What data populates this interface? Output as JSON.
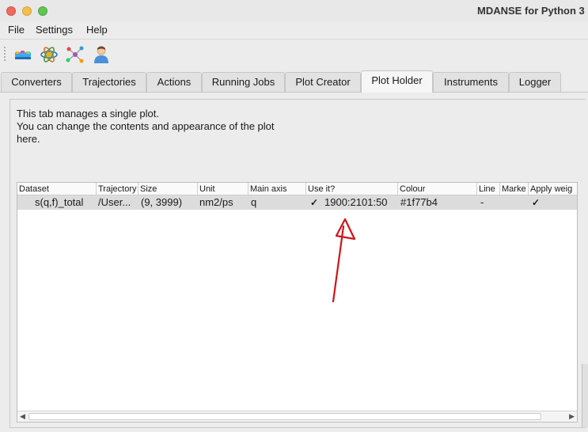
{
  "window": {
    "title": "MDANSE for Python 3"
  },
  "menu": [
    "File",
    "Settings",
    "Help"
  ],
  "toolbar": {
    "icons": [
      "loader-icon",
      "atom-icon",
      "network-icon",
      "user-icon"
    ]
  },
  "tabs": [
    "Converters",
    "Trajectories",
    "Actions",
    "Running Jobs",
    "Plot Creator",
    "Plot Holder",
    "Instruments",
    "Logger"
  ],
  "active_tab": "Plot Holder",
  "info": {
    "line1": "This tab manages a single plot.",
    "line2": "You can change the contents and appearance of the plot",
    "line3": "here."
  },
  "table": {
    "headers": [
      "Dataset",
      "Trajectory",
      "Size",
      "Unit",
      "Main axis",
      "Use it?",
      "Colour",
      "Line",
      "Marke",
      "Apply weig"
    ],
    "row": {
      "dataset": "s(q,f)_total",
      "trajectory": "/User...",
      "size": "(9, 3999)",
      "unit": "nm2/ps",
      "main_axis": "q",
      "use_it": true,
      "range": "1900:2101:50",
      "colour": "#1f77b4",
      "line": "-",
      "marker": "",
      "apply_weights": true
    }
  },
  "colors": {
    "arrow": "#d0141a",
    "selected_row": "#dcdcdc"
  }
}
